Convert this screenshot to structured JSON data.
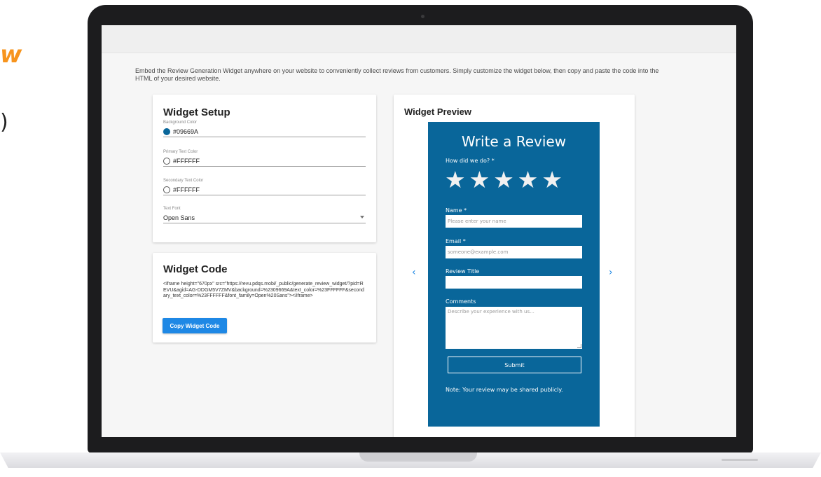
{
  "side_text": {
    "orange_letter": "w",
    "dark_letter": ")"
  },
  "intro": "Embed the Review Generation Widget anywhere on your website to conveniently collect reviews from customers. Simply customize the widget below, then copy and paste the code into the HTML of your desired website.",
  "widget_setup": {
    "title": "Widget Setup",
    "background_color": {
      "label": "Background Color",
      "value": "#09669A",
      "swatch": "#09669A"
    },
    "primary_text_color": {
      "label": "Primary Text Color",
      "value": "#FFFFFF",
      "swatch": "#FFFFFF"
    },
    "secondary_text_color": {
      "label": "Secondary Text Color",
      "value": "#FFFFFF",
      "swatch": "#FFFFFF"
    },
    "text_font": {
      "label": "Text Font",
      "value": "Open Sans"
    }
  },
  "widget_code": {
    "title": "Widget Code",
    "code": "<iframe height=\"670px\" src=\"https://revu.pdqs.mobi/_public/generate_review_widget/?pid=REVU&agid=AG-DDGM5V7ZMV&background=%2309669A&text_color=%23FFFFFF&secondary_text_color=%23FFFFFF&font_family=Open%20Sans\"></iframe>",
    "copy_button": "Copy Widget Code"
  },
  "widget_preview": {
    "title": "Widget Preview",
    "prev_icon": "chevron-left-icon",
    "next_icon": "chevron-right-icon",
    "form": {
      "heading": "Write a Review",
      "rating_label": "How did we do? *",
      "star_count": 5,
      "name_label": "Name *",
      "name_placeholder": "Please enter your name",
      "email_label": "Email *",
      "email_placeholder": "someone@example.com",
      "review_title_label": "Review Title",
      "review_title_placeholder": "",
      "comments_label": "Comments",
      "comments_placeholder": "Describe your experience with us...",
      "submit": "Submit",
      "note": "Note: Your review may be shared publicly."
    }
  },
  "colors": {
    "accent": "#1E88E5",
    "widget_background": "#09669A",
    "brand_orange": "#F7941D"
  }
}
